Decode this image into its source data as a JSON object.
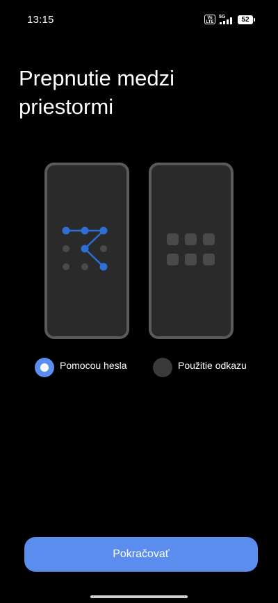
{
  "status_bar": {
    "time": "13:15",
    "volte_label": "Vo LTE",
    "network_label": "5G",
    "battery_level": "52"
  },
  "title": "Prepnutie medzi priestormi",
  "illustrations": {
    "left_icon": "pattern-lock-icon",
    "right_icon": "app-grid-icon"
  },
  "options": [
    {
      "label": "Pomocou hesla",
      "selected": true
    },
    {
      "label": "Použitie odkazu",
      "selected": false
    }
  ],
  "continue_button": {
    "label": "Pokračovať"
  },
  "colors": {
    "accent": "#5b8def",
    "pattern_dot_active": "#2f6ed6",
    "background": "#000000",
    "phone_screen": "#2a2a2a"
  }
}
